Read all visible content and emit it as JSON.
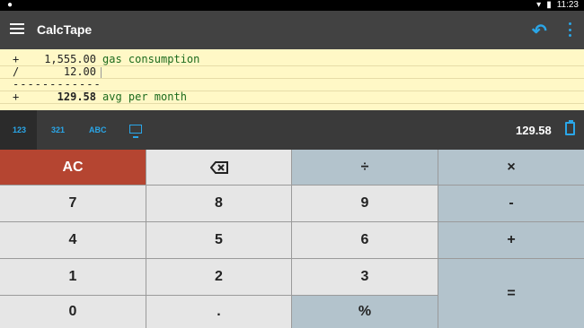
{
  "status": {
    "time": "11:23"
  },
  "appbar": {
    "title": "CalcTape"
  },
  "tape": [
    {
      "op": "+",
      "value": "1,555.00",
      "note": "gas consumption"
    },
    {
      "op": "/",
      "value": "12.00",
      "note": ""
    },
    {
      "separator": "------------"
    },
    {
      "op": "+",
      "value": "129.58",
      "note": "avg per month"
    }
  ],
  "toolbar": {
    "modes": [
      "123",
      "321",
      "ABC"
    ],
    "result": "129.58"
  },
  "keys": {
    "ac": "AC",
    "divide": "÷",
    "multiply": "×",
    "seven": "7",
    "eight": "8",
    "nine": "9",
    "minus": "-",
    "four": "4",
    "five": "5",
    "six": "6",
    "plus": "+",
    "one": "1",
    "two": "2",
    "three": "3",
    "equals": "=",
    "zero": "0",
    "dot": ".",
    "percent": "%"
  }
}
